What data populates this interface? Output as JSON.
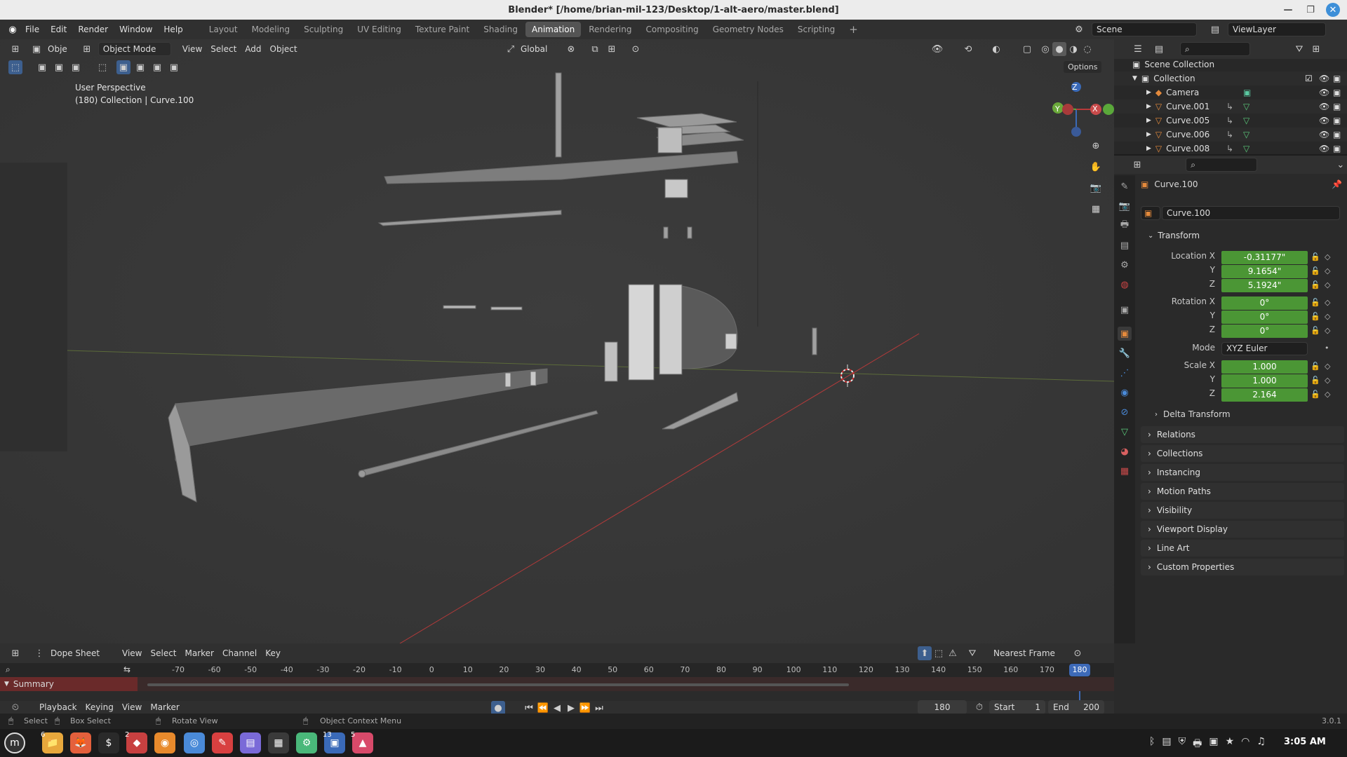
{
  "window": {
    "title": "Blender* [/home/brian-mil-123/Desktop/1-alt-aero/master.blend]"
  },
  "menu": [
    "File",
    "Edit",
    "Render",
    "Window",
    "Help"
  ],
  "workspaces": [
    "Layout",
    "Modeling",
    "Sculpting",
    "UV Editing",
    "Texture Paint",
    "Shading",
    "Animation",
    "Rendering",
    "Compositing",
    "Geometry Nodes",
    "Scripting"
  ],
  "active_workspace": "Animation",
  "scene": {
    "name": "Scene",
    "view_layer": "ViewLayer"
  },
  "viewport": {
    "editor_label": "Obje",
    "mode": "Object Mode",
    "menus": [
      "View",
      "Select",
      "Add",
      "Object"
    ],
    "orientation": "Global",
    "options": "Options",
    "info_line1": "User Perspective",
    "info_line2": "(180) Collection | Curve.100",
    "gizmo": {
      "z": "Z",
      "y": "Y",
      "x": "X"
    }
  },
  "outliner": {
    "scene_collection": "Scene Collection",
    "collection": "Collection",
    "items": [
      "Camera",
      "Curve.001",
      "Curve.005",
      "Curve.006",
      "Curve.008"
    ]
  },
  "properties": {
    "object_name": "Curve.100",
    "datablock": "Curve.100",
    "transform_label": "Transform",
    "location_label": "Location X",
    "rotation_label": "Rotation X",
    "scale_label": "Scale X",
    "y_label": "Y",
    "z_label": "Z",
    "location": [
      "-0.31177\"",
      "9.1654\"",
      "5.1924\""
    ],
    "rotation": [
      "0°",
      "0°",
      "0°"
    ],
    "mode_label": "Mode",
    "mode_value": "XYZ Euler",
    "scale": [
      "1.000",
      "1.000",
      "2.164"
    ],
    "delta": "Delta Transform",
    "panels": [
      "Relations",
      "Collections",
      "Instancing",
      "Motion Paths",
      "Visibility",
      "Viewport Display",
      "Line Art",
      "Custom Properties"
    ]
  },
  "dopesheet": {
    "editor": "Dope Sheet",
    "menus": [
      "View",
      "Select",
      "Marker",
      "Channel",
      "Key"
    ],
    "snap": "Nearest Frame",
    "summary": "Summary",
    "ruler": [
      "-70",
      "-60",
      "-50",
      "-40",
      "-30",
      "-20",
      "-10",
      "0",
      "10",
      "20",
      "30",
      "40",
      "50",
      "60",
      "70",
      "80",
      "90",
      "100",
      "110",
      "120",
      "130",
      "140",
      "150",
      "160",
      "170"
    ],
    "current_frame_badge": "180"
  },
  "timeline": {
    "menus": [
      "Playback",
      "Keying",
      "View",
      "Marker"
    ],
    "frame": "180",
    "start_label": "Start",
    "start": "1",
    "end_label": "End",
    "end": "200"
  },
  "status": {
    "select": "Select",
    "box_select": "Box Select",
    "rotate_view": "Rotate View",
    "context_menu": "Object Context Menu",
    "version": "3.0.1"
  },
  "taskbar": {
    "badges": [
      "6",
      "2",
      "13",
      "5"
    ],
    "clock": "3:05 AM"
  }
}
